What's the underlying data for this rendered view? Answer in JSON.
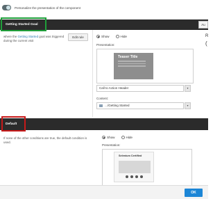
{
  "topbar": {
    "toggle_label": "Personalize the presentation of the component"
  },
  "rule": {
    "title": "Getting Started Goal",
    "condition_prefix": "where the ",
    "condition_link": "Getting Started",
    "condition_suffix": " goal was triggered during the current visit",
    "edit_button": "Edit rule",
    "tab_label": "Au",
    "show_label": "Show",
    "hide_label": "Hide",
    "presentation_label": "Presentation:",
    "teaser_title": "Teaser Title",
    "presentation_select": "Call to Action Header",
    "content_label": "Content:",
    "content_value": ".../Getting Started",
    "right_letters": [
      "R",
      "("
    ]
  },
  "default_rule": {
    "title": "Default",
    "description": "If none of the other conditions are true, the default condition is used.",
    "show_label": "Show",
    "hide_label": "Hide",
    "presentation_label": "Presentation:",
    "card_title": "Selenium Certified"
  },
  "footer": {
    "ok_button": "OK"
  },
  "colors": {
    "header_bg": "#2b2b2b",
    "highlight_green": "#1f9f3a",
    "highlight_red": "#c81a1a",
    "ok_blue": "#1c86d6",
    "link_blue": "#2a7ab0"
  }
}
